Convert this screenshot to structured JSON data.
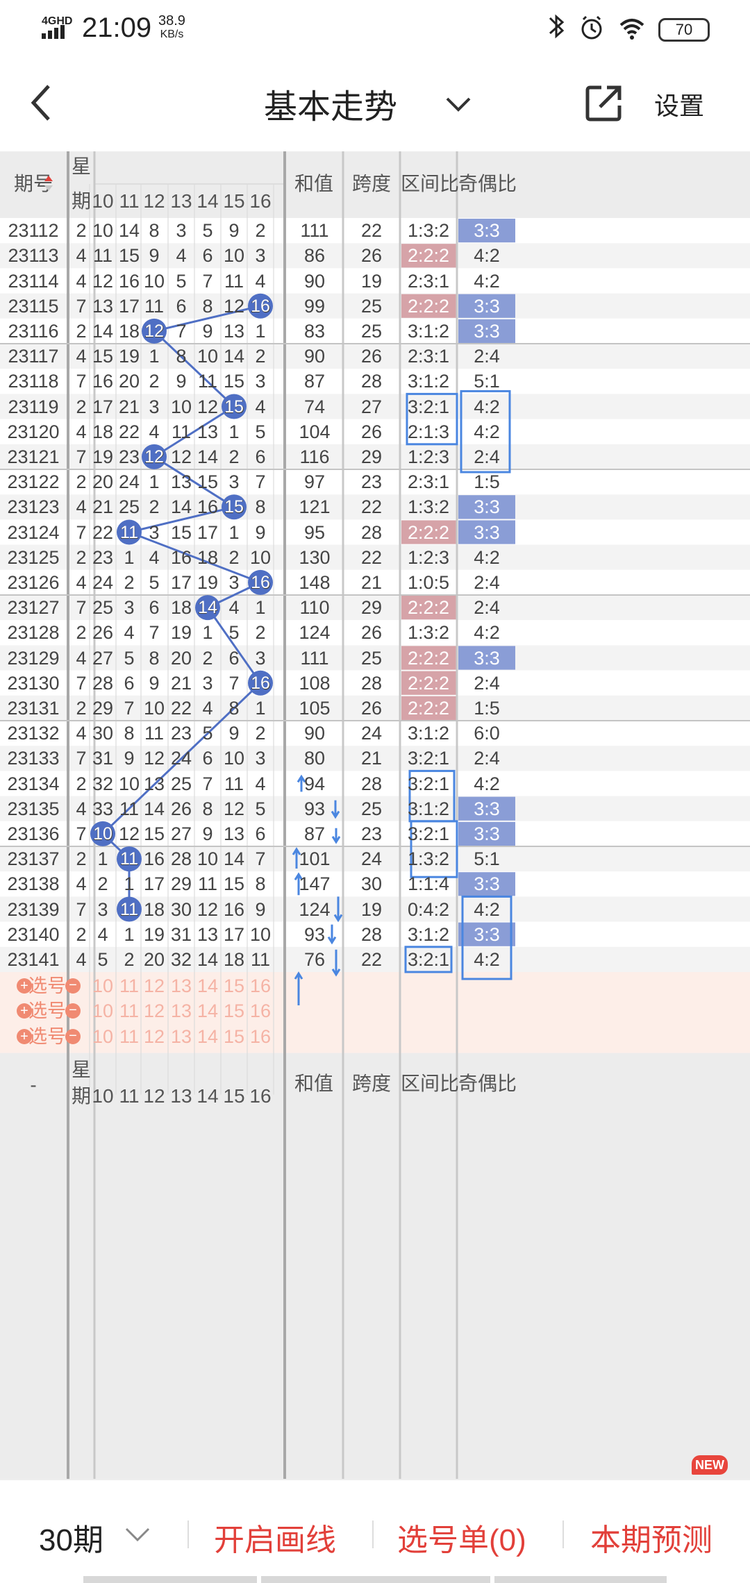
{
  "status": {
    "network": "4GHD",
    "time": "21:09",
    "speed_value": "38.9",
    "speed_unit": "KB/s",
    "battery": "70"
  },
  "nav": {
    "title": "基本走势",
    "settings": "设置"
  },
  "header": {
    "period": "期号",
    "week_top": "星",
    "week_bottom": "期",
    "numbers": [
      "10",
      "11",
      "12",
      "13",
      "14",
      "15",
      "16"
    ],
    "sum": "和值",
    "span": "跨度",
    "interval_ratio": "区间比",
    "odd_even_ratio": "奇偶比"
  },
  "rows": [
    {
      "p": "23112",
      "w": "2",
      "n": [
        "10",
        "14",
        "8",
        "3",
        "5",
        "9",
        "2"
      ],
      "sum": "111",
      "span": "22",
      "ir": "1:3:2",
      "oe": "3:3",
      "irh": false,
      "oeh": true
    },
    {
      "p": "23113",
      "w": "4",
      "n": [
        "11",
        "15",
        "9",
        "4",
        "6",
        "10",
        "3"
      ],
      "sum": "86",
      "span": "26",
      "ir": "2:2:2",
      "oe": "4:2",
      "irh": true,
      "oeh": false
    },
    {
      "p": "23114",
      "w": "4",
      "n": [
        "12",
        "16",
        "10",
        "5",
        "7",
        "11",
        "4"
      ],
      "sum": "90",
      "span": "19",
      "ir": "2:3:1",
      "oe": "4:2",
      "irh": false,
      "oeh": false
    },
    {
      "p": "23115",
      "w": "7",
      "n": [
        "13",
        "17",
        "11",
        "6",
        "8",
        "12",
        "16"
      ],
      "sum": "99",
      "span": "25",
      "ir": "2:2:2",
      "oe": "3:3",
      "irh": true,
      "oeh": true
    },
    {
      "p": "23116",
      "w": "2",
      "n": [
        "14",
        "18",
        "12",
        "7",
        "9",
        "13",
        "1"
      ],
      "sum": "83",
      "span": "25",
      "ir": "3:1:2",
      "oe": "3:3",
      "irh": false,
      "oeh": true
    },
    {
      "p": "23117",
      "w": "4",
      "n": [
        "15",
        "19",
        "1",
        "8",
        "10",
        "14",
        "2"
      ],
      "sum": "90",
      "span": "26",
      "ir": "2:3:1",
      "oe": "2:4",
      "irh": false,
      "oeh": false
    },
    {
      "p": "23118",
      "w": "7",
      "n": [
        "16",
        "20",
        "2",
        "9",
        "11",
        "15",
        "3"
      ],
      "sum": "87",
      "span": "28",
      "ir": "3:1:2",
      "oe": "5:1",
      "irh": false,
      "oeh": false
    },
    {
      "p": "23119",
      "w": "2",
      "n": [
        "17",
        "21",
        "3",
        "10",
        "12",
        "15",
        "4"
      ],
      "sum": "74",
      "span": "27",
      "ir": "3:2:1",
      "oe": "4:2",
      "irh": false,
      "oeh": false
    },
    {
      "p": "23120",
      "w": "4",
      "n": [
        "18",
        "22",
        "4",
        "11",
        "13",
        "1",
        "5"
      ],
      "sum": "104",
      "span": "26",
      "ir": "2:1:3",
      "oe": "4:2",
      "irh": false,
      "oeh": false
    },
    {
      "p": "23121",
      "w": "7",
      "n": [
        "19",
        "23",
        "12",
        "12",
        "14",
        "2",
        "6"
      ],
      "sum": "116",
      "span": "29",
      "ir": "1:2:3",
      "oe": "2:4",
      "irh": false,
      "oeh": false
    },
    {
      "p": "23122",
      "w": "2",
      "n": [
        "20",
        "24",
        "1",
        "13",
        "15",
        "3",
        "7"
      ],
      "sum": "97",
      "span": "23",
      "ir": "2:3:1",
      "oe": "1:5",
      "irh": false,
      "oeh": false
    },
    {
      "p": "23123",
      "w": "4",
      "n": [
        "21",
        "25",
        "2",
        "14",
        "16",
        "15",
        "8"
      ],
      "sum": "121",
      "span": "22",
      "ir": "1:3:2",
      "oe": "3:3",
      "irh": false,
      "oeh": true
    },
    {
      "p": "23124",
      "w": "7",
      "n": [
        "22",
        "11",
        "3",
        "15",
        "17",
        "1",
        "9"
      ],
      "sum": "95",
      "span": "28",
      "ir": "2:2:2",
      "oe": "3:3",
      "irh": true,
      "oeh": true
    },
    {
      "p": "23125",
      "w": "2",
      "n": [
        "23",
        "1",
        "4",
        "16",
        "18",
        "2",
        "10"
      ],
      "sum": "130",
      "span": "22",
      "ir": "1:2:3",
      "oe": "4:2",
      "irh": false,
      "oeh": false
    },
    {
      "p": "23126",
      "w": "4",
      "n": [
        "24",
        "2",
        "5",
        "17",
        "19",
        "3",
        "16"
      ],
      "sum": "148",
      "span": "21",
      "ir": "1:0:5",
      "oe": "2:4",
      "irh": false,
      "oeh": false
    },
    {
      "p": "23127",
      "w": "7",
      "n": [
        "25",
        "3",
        "6",
        "18",
        "14",
        "4",
        "1"
      ],
      "sum": "110",
      "span": "29",
      "ir": "2:2:2",
      "oe": "2:4",
      "irh": true,
      "oeh": false
    },
    {
      "p": "23128",
      "w": "2",
      "n": [
        "26",
        "4",
        "7",
        "19",
        "1",
        "5",
        "2"
      ],
      "sum": "124",
      "span": "26",
      "ir": "1:3:2",
      "oe": "4:2",
      "irh": false,
      "oeh": false
    },
    {
      "p": "23129",
      "w": "4",
      "n": [
        "27",
        "5",
        "8",
        "20",
        "2",
        "6",
        "3"
      ],
      "sum": "111",
      "span": "25",
      "ir": "2:2:2",
      "oe": "3:3",
      "irh": true,
      "oeh": true
    },
    {
      "p": "23130",
      "w": "7",
      "n": [
        "28",
        "6",
        "9",
        "21",
        "3",
        "7",
        "16"
      ],
      "sum": "108",
      "span": "28",
      "ir": "2:2:2",
      "oe": "2:4",
      "irh": true,
      "oeh": false
    },
    {
      "p": "23131",
      "w": "2",
      "n": [
        "29",
        "7",
        "10",
        "22",
        "4",
        "8",
        "1"
      ],
      "sum": "105",
      "span": "26",
      "ir": "2:2:2",
      "oe": "1:5",
      "irh": true,
      "oeh": false
    },
    {
      "p": "23132",
      "w": "4",
      "n": [
        "30",
        "8",
        "11",
        "23",
        "5",
        "9",
        "2"
      ],
      "sum": "90",
      "span": "24",
      "ir": "3:1:2",
      "oe": "6:0",
      "irh": false,
      "oeh": false
    },
    {
      "p": "23133",
      "w": "7",
      "n": [
        "31",
        "9",
        "12",
        "24",
        "6",
        "10",
        "3"
      ],
      "sum": "80",
      "span": "21",
      "ir": "3:2:1",
      "oe": "2:4",
      "irh": false,
      "oeh": false
    },
    {
      "p": "23134",
      "w": "2",
      "n": [
        "32",
        "10",
        "13",
        "25",
        "7",
        "11",
        "4"
      ],
      "sum": "94",
      "span": "28",
      "ir": "3:2:1",
      "oe": "4:2",
      "irh": false,
      "oeh": false
    },
    {
      "p": "23135",
      "w": "4",
      "n": [
        "33",
        "11",
        "14",
        "26",
        "8",
        "12",
        "5"
      ],
      "sum": "93",
      "span": "25",
      "ir": "3:1:2",
      "oe": "3:3",
      "irh": false,
      "oeh": true
    },
    {
      "p": "23136",
      "w": "7",
      "n": [
        "10",
        "12",
        "15",
        "27",
        "9",
        "13",
        "6"
      ],
      "sum": "87",
      "span": "23",
      "ir": "3:2:1",
      "oe": "3:3",
      "irh": false,
      "oeh": true
    },
    {
      "p": "23137",
      "w": "2",
      "n": [
        "1",
        "11",
        "16",
        "28",
        "10",
        "14",
        "7"
      ],
      "sum": "101",
      "span": "24",
      "ir": "1:3:2",
      "oe": "5:1",
      "irh": false,
      "oeh": false
    },
    {
      "p": "23138",
      "w": "4",
      "n": [
        "2",
        "1",
        "17",
        "29",
        "11",
        "15",
        "8"
      ],
      "sum": "147",
      "span": "30",
      "ir": "1:1:4",
      "oe": "3:3",
      "irh": false,
      "oeh": true
    },
    {
      "p": "23139",
      "w": "7",
      "n": [
        "3",
        "11",
        "18",
        "30",
        "12",
        "16",
        "9"
      ],
      "sum": "124",
      "span": "19",
      "ir": "0:4:2",
      "oe": "4:2",
      "irh": false,
      "oeh": false
    },
    {
      "p": "23140",
      "w": "2",
      "n": [
        "4",
        "1",
        "19",
        "31",
        "13",
        "17",
        "10"
      ],
      "sum": "93",
      "span": "28",
      "ir": "3:1:2",
      "oe": "3:3",
      "irh": false,
      "oeh": true
    },
    {
      "p": "23141",
      "w": "4",
      "n": [
        "5",
        "2",
        "20",
        "32",
        "14",
        "18",
        "11"
      ],
      "sum": "76",
      "span": "22",
      "ir": "3:2:1",
      "oe": "4:2",
      "irh": false,
      "oeh": false
    }
  ],
  "balls": [
    {
      "row": 3,
      "col": 6,
      "value": "16"
    },
    {
      "row": 4,
      "col": 2,
      "value": "12"
    },
    {
      "row": 7,
      "col": 5,
      "value": "15"
    },
    {
      "row": 9,
      "col": 2,
      "value": "12"
    },
    {
      "row": 11,
      "col": 5,
      "value": "15"
    },
    {
      "row": 12,
      "col": 1,
      "value": "11"
    },
    {
      "row": 14,
      "col": 6,
      "value": "16"
    },
    {
      "row": 15,
      "col": 4,
      "value": "14"
    },
    {
      "row": 18,
      "col": 6,
      "value": "16"
    },
    {
      "row": 24,
      "col": 0,
      "value": "10"
    },
    {
      "row": 25,
      "col": 1,
      "value": "11"
    },
    {
      "row": 27,
      "col": 1,
      "value": "11"
    }
  ],
  "pick": {
    "label": "选号",
    "numbers": [
      "10",
      "11",
      "12",
      "13",
      "14",
      "15",
      "16"
    ]
  },
  "footer": {
    "period": "-",
    "week_top": "星",
    "week_bottom": "期",
    "numbers": [
      "10",
      "11",
      "12",
      "13",
      "14",
      "15",
      "16"
    ],
    "sum": "和值",
    "span": "跨度",
    "interval_ratio": "区间比",
    "odd_even_ratio": "奇偶比"
  },
  "bottom": {
    "periods": "30期",
    "draw": "开启画线",
    "selection": "选号单(0)",
    "predict": "本期预测",
    "new_badge": "NEW"
  },
  "colors": {
    "ball": "#4f6fc4",
    "odd_even_highlight": "#8a9dd6",
    "interval_highlight": "#d6a3a8",
    "accent_red": "#e2403a",
    "pick_bg": "#fdeee8"
  }
}
